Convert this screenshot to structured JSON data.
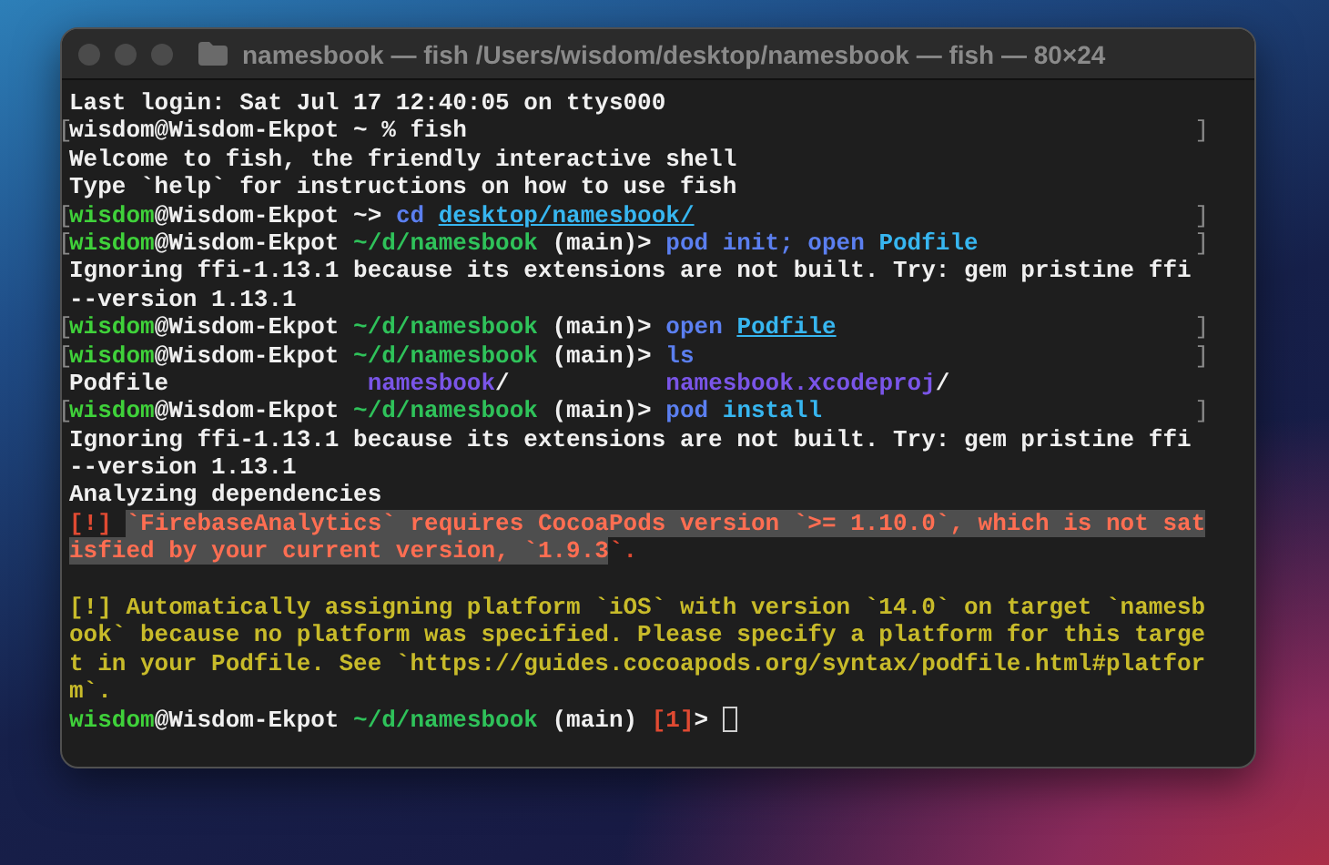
{
  "window": {
    "title": "namesbook — fish /Users/wisdom/desktop/namesbook — fish — 80×24",
    "active": false
  },
  "lines": [
    {
      "segments": [
        {
          "text": "Last login: Sat Jul 17 12:40:05 on ttys000",
          "kind": "plain"
        }
      ]
    },
    {
      "mark_open": "[",
      "mark_close": "]",
      "segments": [
        {
          "text": "wisdom@Wisdom-Ekpot ~ % fish",
          "kind": "plain"
        }
      ]
    },
    {
      "segments": [
        {
          "text": "Welcome to fish, the friendly interactive shell",
          "kind": "plain"
        }
      ]
    },
    {
      "segments": [
        {
          "text": "Type `help` for instructions on how to use fish",
          "kind": "plain"
        }
      ]
    },
    {
      "mark_open": "[",
      "mark_close": "]",
      "segments": [
        {
          "text": "wisdom",
          "kind": "user"
        },
        {
          "text": "@Wisdom-Ekpot ~> ",
          "kind": "plain"
        },
        {
          "text": "cd ",
          "kind": "command"
        },
        {
          "text": "desktop/namesbook/",
          "kind": "path-arg"
        }
      ]
    },
    {
      "mark_open": "[",
      "mark_close": "]",
      "segments": [
        {
          "text": "wisdom",
          "kind": "user"
        },
        {
          "text": "@Wisdom-Ekpot ",
          "kind": "plain"
        },
        {
          "text": "~/d/namesbook",
          "kind": "cwd"
        },
        {
          "text": " (main)> ",
          "kind": "plain"
        },
        {
          "text": "pod init; open ",
          "kind": "command"
        },
        {
          "text": "Podfile",
          "kind": "argument"
        }
      ]
    },
    {
      "segments": [
        {
          "text": "Ignoring ffi-1.13.1 because its extensions are not built. Try: gem pristine ffi",
          "kind": "plain"
        }
      ]
    },
    {
      "segments": [
        {
          "text": "--version 1.13.1",
          "kind": "plain"
        }
      ]
    },
    {
      "mark_open": "[",
      "mark_close": "]",
      "segments": [
        {
          "text": "wisdom",
          "kind": "user"
        },
        {
          "text": "@Wisdom-Ekpot ",
          "kind": "plain"
        },
        {
          "text": "~/d/namesbook",
          "kind": "cwd"
        },
        {
          "text": " (main)> ",
          "kind": "plain"
        },
        {
          "text": "open ",
          "kind": "command"
        },
        {
          "text": "Podfile",
          "kind": "path-arg"
        }
      ]
    },
    {
      "mark_open": "[",
      "mark_close": "]",
      "segments": [
        {
          "text": "wisdom",
          "kind": "user"
        },
        {
          "text": "@Wisdom-Ekpot ",
          "kind": "plain"
        },
        {
          "text": "~/d/namesbook",
          "kind": "cwd"
        },
        {
          "text": " (main)> ",
          "kind": "plain"
        },
        {
          "text": "ls",
          "kind": "command"
        }
      ]
    },
    {
      "segments": [
        {
          "text": "Podfile              ",
          "kind": "plain"
        },
        {
          "text": "namesbook",
          "kind": "directory"
        },
        {
          "text": "/           ",
          "kind": "plain"
        },
        {
          "text": "namesbook.xcodeproj",
          "kind": "directory"
        },
        {
          "text": "/",
          "kind": "plain"
        }
      ]
    },
    {
      "mark_open": "[",
      "mark_close": "]",
      "segments": [
        {
          "text": "wisdom",
          "kind": "user"
        },
        {
          "text": "@Wisdom-Ekpot ",
          "kind": "plain"
        },
        {
          "text": "~/d/namesbook",
          "kind": "cwd"
        },
        {
          "text": " (main)> ",
          "kind": "plain"
        },
        {
          "text": "pod ",
          "kind": "command"
        },
        {
          "text": "install",
          "kind": "argument"
        }
      ]
    },
    {
      "segments": [
        {
          "text": "Ignoring ffi-1.13.1 because its extensions are not built. Try: gem pristine ffi",
          "kind": "plain"
        }
      ]
    },
    {
      "segments": [
        {
          "text": "--version 1.13.1",
          "kind": "plain"
        }
      ]
    },
    {
      "segments": [
        {
          "text": "Analyzing dependencies",
          "kind": "plain"
        }
      ]
    },
    {
      "segments": [
        {
          "text": "[!] ",
          "kind": "error"
        },
        {
          "text": "`FirebaseAnalytics` requires CocoaPods version `>= 1.10.0`, which is not sat",
          "kind": "error-selected"
        }
      ]
    },
    {
      "segments": [
        {
          "text": "isfied by your current version, `1.9.3",
          "kind": "error-selected"
        },
        {
          "text": "`.",
          "kind": "error"
        }
      ]
    },
    {
      "gap_before": true,
      "segments": [
        {
          "text": "[!] Automatically assigning platform `iOS` with version `14.0` on target `namesb",
          "kind": "warning"
        }
      ]
    },
    {
      "segments": [
        {
          "text": "ook` because no platform was specified. Please specify a platform for this targe",
          "kind": "warning"
        }
      ]
    },
    {
      "segments": [
        {
          "text": "t in your Podfile. See `https://guides.cocoapods.org/syntax/podfile.html#platfor",
          "kind": "warning"
        }
      ]
    },
    {
      "segments": [
        {
          "text": "m`.",
          "kind": "warning"
        }
      ]
    },
    {
      "cursor": true,
      "segments": [
        {
          "text": "wisdom",
          "kind": "user"
        },
        {
          "text": "@Wisdom-Ekpot ",
          "kind": "plain"
        },
        {
          "text": "~/d/namesbook",
          "kind": "cwd"
        },
        {
          "text": " (main) ",
          "kind": "plain"
        },
        {
          "text": "[1]",
          "kind": "error"
        },
        {
          "text": "> ",
          "kind": "plain"
        }
      ]
    }
  ]
}
